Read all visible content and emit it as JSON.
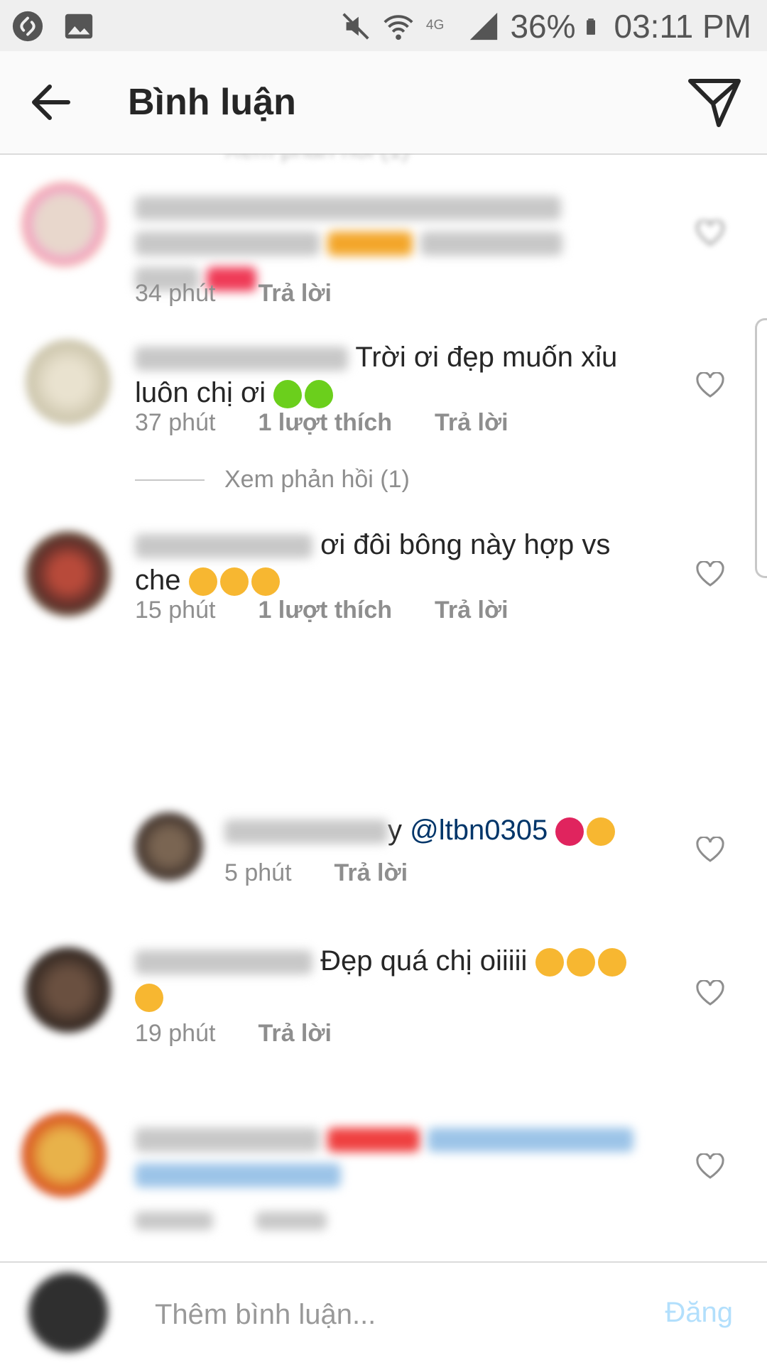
{
  "status_bar": {
    "battery": "36%",
    "time": "03:11 PM",
    "icons": [
      "shazam-icon",
      "image-icon",
      "mute-icon",
      "wifi-icon",
      "4g-icon",
      "signal-icon",
      "battery-icon"
    ]
  },
  "header": {
    "title": "Bình luận",
    "back_icon": "arrow-left-icon",
    "share_icon": "paper-plane-icon"
  },
  "comments": [
    {
      "text": "",
      "time": "34 phút",
      "likes": "",
      "reply": "Trả lời"
    },
    {
      "text": "Trời ơi đẹp muốn xỉu luôn chị ơi",
      "time": "37 phút",
      "likes": "1 lượt thích",
      "reply": "Trả lời",
      "view_replies": "Xem phản hồi (1)"
    },
    {
      "text": "ơi đôi bông này hợp vs che",
      "time": "15 phút",
      "likes": "1 lượt thích",
      "reply": "Trả lời"
    },
    {
      "text": "y",
      "mention": "@ltbn0305",
      "time": "5 phút",
      "reply": "Trả lời"
    },
    {
      "text": "Đẹp quá chị oiiiii",
      "time": "19 phút",
      "reply": "Trả lời"
    }
  ],
  "composer": {
    "placeholder": "Thêm bình luận...",
    "post_label": "Đăng"
  },
  "colors": {
    "accent": "#3897f0",
    "post_disabled": "#b2dffc",
    "mention": "#003569",
    "meta": "#8e8e8e"
  }
}
